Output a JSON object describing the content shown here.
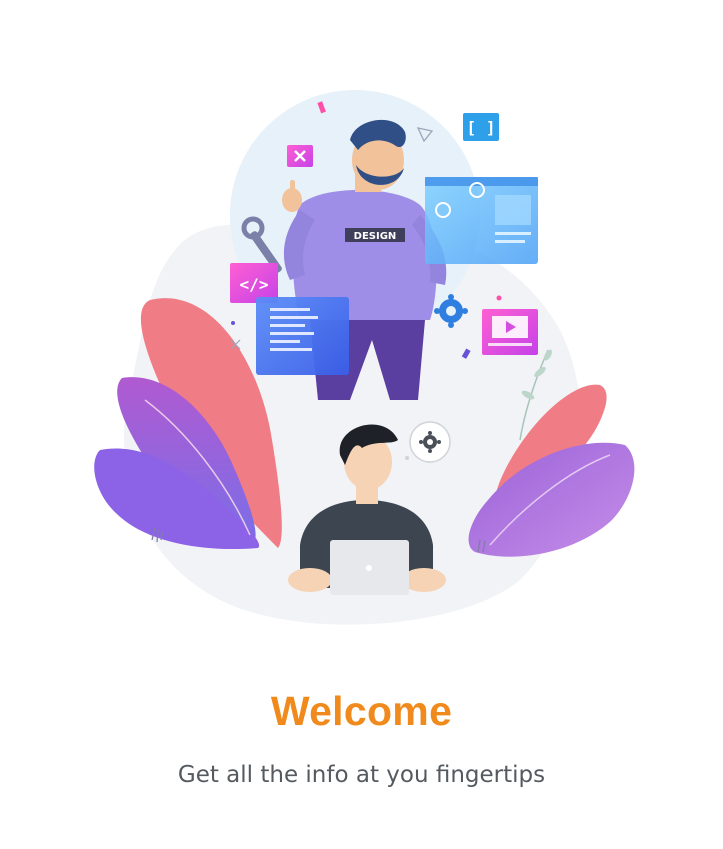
{
  "illustration": {
    "badge_design": "DESIGN",
    "code_glyph": "</>",
    "bracket_glyph": "[ ]",
    "icons": [
      "close-icon",
      "code-icon",
      "wrench-icon",
      "gear-icon",
      "play-icon",
      "bracket-icon"
    ]
  },
  "welcome": {
    "title": "Welcome",
    "subtitle": "Get all the info at you fingertips"
  },
  "colors": {
    "title": "#F08A1C",
    "subtitle": "#555a60",
    "accent_purple": "#8C63E6",
    "accent_pink": "#F07C86",
    "accent_blue": "#4F8BF5"
  }
}
